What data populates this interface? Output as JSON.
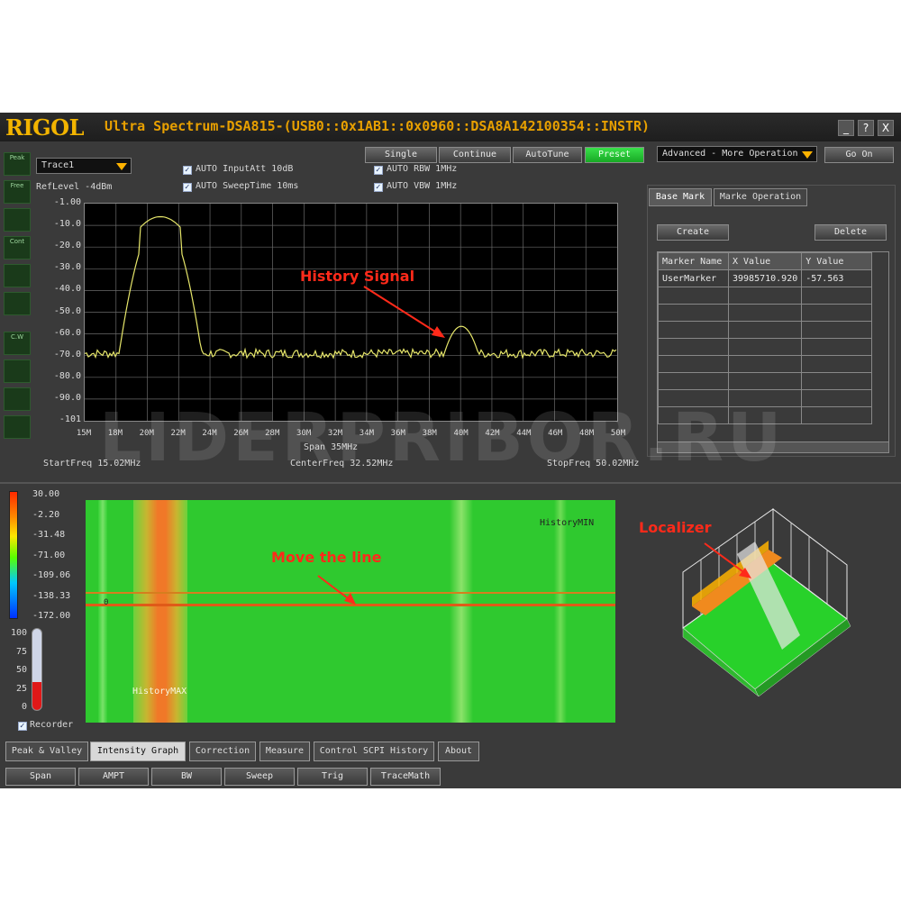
{
  "window": {
    "logo": "RIGOL",
    "title": "Ultra Spectrum-DSA815-(USB0::0x1AB1::0x0960::DSA8A142100354::INSTR)",
    "controls": [
      "_",
      "?",
      "X"
    ]
  },
  "left_toolbar": [
    "Peak",
    "Free",
    "",
    "Cont",
    "",
    "",
    "C.W",
    "",
    "",
    ""
  ],
  "trace_select": "Trace1",
  "settings": {
    "ref_level": "RefLevel  -4dBm",
    "auto_input_att": "AUTO InputAtt  10dB",
    "auto_sweep_time": "AUTO SweepTime  10ms",
    "auto_rbw": "AUTO RBW     1MHz",
    "auto_vbw": "AUTO VBW     1MHz"
  },
  "top_buttons": [
    "Single",
    "Continue",
    "AutoTune",
    "Preset"
  ],
  "mode_select": "Advanced - More Operation",
  "go_on": "Go On",
  "spectrum": {
    "y_ticks": [
      "-1.00",
      "-10.0",
      "-20.0",
      "-30.0",
      "-40.0",
      "-50.0",
      "-60.0",
      "-70.0",
      "-80.0",
      "-90.0",
      "-101"
    ],
    "x_ticks": [
      "15M",
      "18M",
      "20M",
      "22M",
      "24M",
      "26M",
      "28M",
      "30M",
      "32M",
      "34M",
      "36M",
      "38M",
      "40M",
      "42M",
      "44M",
      "46M",
      "48M",
      "50M"
    ],
    "span": "Span  35MHz",
    "start_freq": "StartFreq  15.02MHz",
    "center_freq": "CenterFreq  32.52MHz",
    "stop_freq": "StopFreq  50.02MHz",
    "annotation": "History Signal",
    "trace_color": "#e6e66a"
  },
  "marker_panel": {
    "tabs": [
      "Base Mark",
      "Marke Operation"
    ],
    "create": "Create",
    "delete": "Delete",
    "columns": [
      "Marker Name",
      "X Value",
      "Y Value"
    ],
    "rows": [
      [
        "UserMarker",
        "39985710.920",
        "-57.563"
      ]
    ]
  },
  "intensity": {
    "scale_labels": [
      "30.00",
      "-2.20",
      "-31.48",
      "-71.00",
      "-109.06",
      "-138.33",
      "-172.00"
    ],
    "history_max": "HistoryMAX",
    "history_min": "HistoryMIN",
    "annotation": "Move the line",
    "line_marker": "0"
  },
  "thermometer": {
    "labels": [
      "100",
      "75",
      "50",
      "25",
      "0"
    ],
    "level_percent": 35,
    "recorder": "Recorder"
  },
  "localizer": {
    "annotation": "Localizer"
  },
  "bottom_tabs": [
    "Peak & Valley",
    "Intensity Graph",
    "Correction",
    "Measure",
    "Control SCPI History",
    "About"
  ],
  "bottom_buttons": [
    "Span",
    "AMPT",
    "BW",
    "Sweep",
    "Trig",
    "TraceMath"
  ],
  "watermark": "LIDERPRIBOR.RU",
  "colors": {
    "accent": "#f2b400",
    "active_button": "#22c431",
    "annotation": "#ff2a1a",
    "waterfall_bg": "#2fc92f"
  }
}
